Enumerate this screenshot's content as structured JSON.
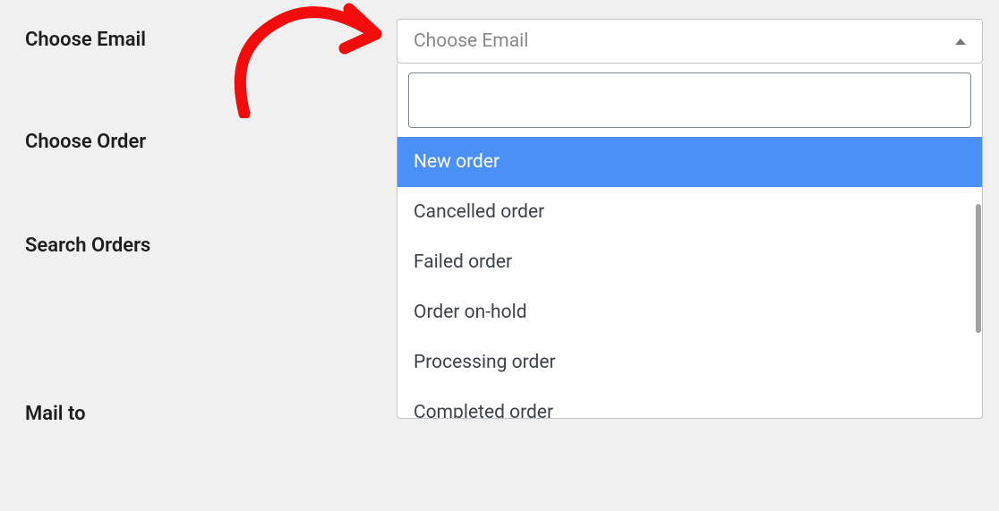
{
  "form": {
    "labels": {
      "choose_email": "Choose Email",
      "choose_order": "Choose Order",
      "search_orders": "Search Orders",
      "mail_to": "Mail to"
    }
  },
  "dropdown": {
    "placeholder": "Choose Email",
    "search_value": "",
    "options": [
      "New order",
      "Cancelled order",
      "Failed order",
      "Order on-hold",
      "Processing order",
      "Completed order"
    ],
    "highlighted_index": 0
  },
  "colors": {
    "highlight": "#4a90f7",
    "annotation": "#f40b0b"
  }
}
